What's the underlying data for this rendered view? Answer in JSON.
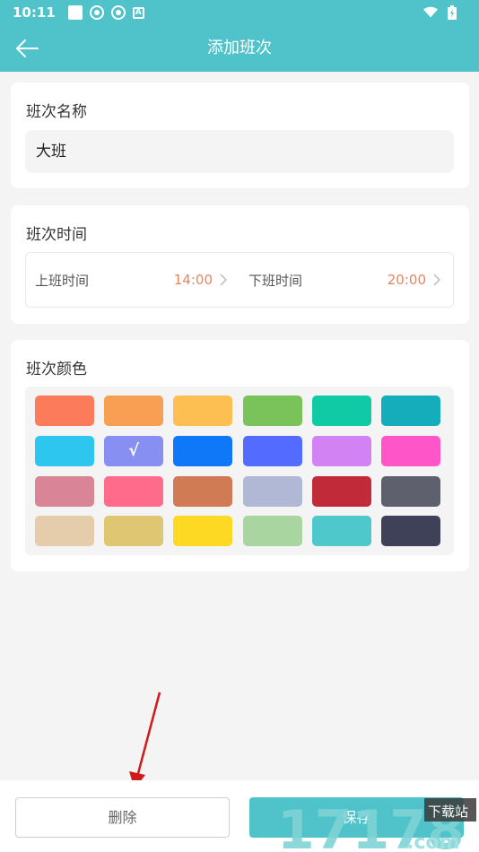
{
  "status_bar": {
    "time": "10:11",
    "icons": [
      "square-icon",
      "settings-icon",
      "settings-icon",
      "a-icon",
      "wifi-icon",
      "battery-charging-icon"
    ]
  },
  "header": {
    "title": "添加班次",
    "back_icon": "arrow-left-icon",
    "bg_color": "#4fc3c9"
  },
  "name_section": {
    "title": "班次名称",
    "value": "大班"
  },
  "time_section": {
    "title": "班次时间",
    "start_label": "上班时间",
    "start_value": "14:00",
    "end_label": "下班时间",
    "end_value": "20:00",
    "value_color": "#e8855d"
  },
  "color_section": {
    "title": "班次颜色",
    "selected_index": 7,
    "check_mark": "√",
    "colors": [
      "#fc7b5a",
      "#f99f53",
      "#fdbf52",
      "#7ac35a",
      "#10c9a5",
      "#15adbc",
      "#2dc6ee",
      "#8790f2",
      "#0f78f8",
      "#536bfe",
      "#d282f2",
      "#fe56c8",
      "#d98497",
      "#fe6b8b",
      "#d17b55",
      "#b1b8d6",
      "#c12b39",
      "#5e606e",
      "#e5ccab",
      "#dfc672",
      "#fdd923",
      "#a9d6a0",
      "#4ec8cb",
      "#3e4157"
    ]
  },
  "actions": {
    "delete_label": "删除",
    "save_label": "保存"
  },
  "watermark": {
    "text": "17178",
    "sub": ".com",
    "tag": "下载站"
  }
}
